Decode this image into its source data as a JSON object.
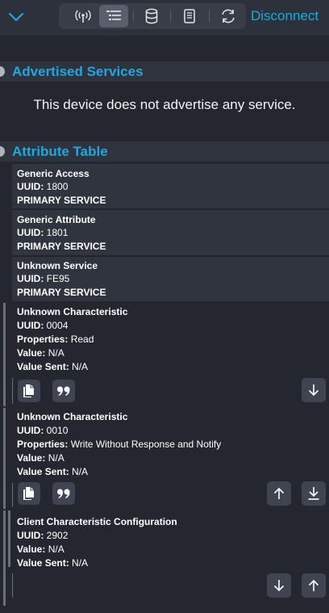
{
  "toolbar": {
    "back_icon": "chevron-down-icon",
    "tools": [
      {
        "name": "advertisement-icon",
        "active": false
      },
      {
        "name": "attribute-list-icon",
        "active": true
      },
      {
        "name": "database-icon",
        "active": false
      },
      {
        "name": "log-book-icon",
        "active": false
      },
      {
        "name": "refresh-icon",
        "active": false
      }
    ],
    "disconnect_label": "Disconnect"
  },
  "advertised": {
    "title": "Advertised Services",
    "empty_text": "This device does not advertise any service."
  },
  "attributes": {
    "title": "Attribute Table",
    "uuid_label": "UUID:",
    "properties_label": "Properties:",
    "value_label": "Value:",
    "value_sent_label": "Value Sent:",
    "services": [
      {
        "name": "Generic Access",
        "uuid": "1800",
        "type": "PRIMARY SERVICE"
      },
      {
        "name": "Generic Attribute",
        "uuid": "1801",
        "type": "PRIMARY SERVICE"
      },
      {
        "name": "Unknown Service",
        "uuid": "FE95",
        "type": "PRIMARY SERVICE"
      }
    ],
    "characteristics": [
      {
        "name": "Unknown Characteristic",
        "uuid": "0004",
        "properties": "Read",
        "value": "N/A",
        "value_sent": "N/A"
      },
      {
        "name": "Unknown Characteristic",
        "uuid": "0010",
        "properties": "Write Without Response and Notify",
        "value": "N/A",
        "value_sent": "N/A"
      }
    ],
    "descriptors": [
      {
        "name": "Client Characteristic Configuration",
        "uuid": "2902",
        "value": "N/A",
        "value_sent": "N/A"
      }
    ]
  },
  "colors": {
    "accent": "#1ea8e0",
    "background": "#24272f",
    "row_background": "#30343e",
    "button_background": "#404451"
  }
}
